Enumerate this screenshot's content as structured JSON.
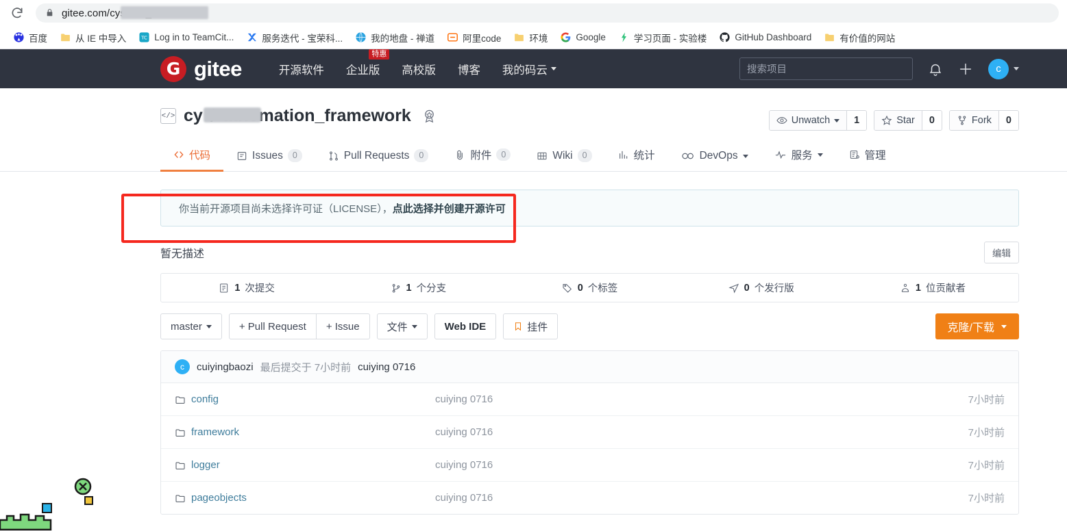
{
  "browser": {
    "reload_icon": "reload-icon",
    "lock_icon": "lock-icon",
    "url": "gitee.com/cysu                        on_framework",
    "bookmarks": [
      {
        "label": "百度",
        "icon": "baidu-icon"
      },
      {
        "label": "从 IE 中导入",
        "icon": "folder-icon"
      },
      {
        "label": "Log in to TeamCit...",
        "icon": "teamcity-icon"
      },
      {
        "label": "服务迭代 - 宝荣科...",
        "icon": "x-blue-icon"
      },
      {
        "label": "我的地盘 - 禅道",
        "icon": "globe-icon"
      },
      {
        "label": "阿里code",
        "icon": "alibaba-code-icon"
      },
      {
        "label": "环境",
        "icon": "folder-icon"
      },
      {
        "label": "Google",
        "icon": "google-icon"
      },
      {
        "label": "学习页面 - 实验楼",
        "icon": "shiyanlou-icon"
      },
      {
        "label": "GitHub Dashboard",
        "icon": "github-icon"
      },
      {
        "label": "有价值的网站",
        "icon": "folder-icon"
      }
    ]
  },
  "site_header": {
    "brand_mark": "G",
    "brand_name": "gitee",
    "nav": [
      {
        "label": "开源软件",
        "badge": "",
        "caret": false
      },
      {
        "label": "企业版",
        "badge": "特惠",
        "caret": false
      },
      {
        "label": "高校版",
        "badge": "",
        "caret": false
      },
      {
        "label": "博客",
        "badge": "",
        "caret": false
      },
      {
        "label": "我的码云",
        "badge": "",
        "caret": true
      }
    ],
    "search_placeholder": "搜索项目",
    "bell_icon": "bell-icon",
    "plus_icon": "plus-icon",
    "avatar_letter": "c"
  },
  "repo": {
    "kind_icon": "code-repo-icon",
    "owner": "cy",
    "separator": "/",
    "name": "automation_framework",
    "medal_icon": "medal-icon",
    "actions": {
      "watch_label": "Unwatch",
      "watch_count": "1",
      "star_label": "Star",
      "star_count": "0",
      "fork_label": "Fork",
      "fork_count": "0"
    },
    "tabs": [
      {
        "label": "代码",
        "count": "",
        "icon": "code-icon",
        "active": true,
        "caret": false
      },
      {
        "label": "Issues",
        "count": "0",
        "icon": "issue-icon",
        "active": false,
        "caret": false
      },
      {
        "label": "Pull Requests",
        "count": "0",
        "icon": "pull-request-icon",
        "active": false,
        "caret": false
      },
      {
        "label": "附件",
        "count": "0",
        "icon": "paperclip-icon",
        "active": false,
        "caret": false
      },
      {
        "label": "Wiki",
        "count": "0",
        "icon": "book-icon",
        "active": false,
        "caret": false
      },
      {
        "label": "统计",
        "count": "",
        "icon": "chart-icon",
        "active": false,
        "caret": false
      },
      {
        "label": "DevOps",
        "count": "",
        "icon": "infinity-icon",
        "active": false,
        "caret": true
      },
      {
        "label": "服务",
        "count": "",
        "icon": "pulse-icon",
        "active": false,
        "caret": true
      },
      {
        "label": "管理",
        "count": "",
        "icon": "settings-list-icon",
        "active": false,
        "caret": false
      }
    ]
  },
  "license_banner": {
    "text": "你当前开源项目尚未选择许可证（LICENSE），",
    "link": "点此选择并创建开源许可"
  },
  "description": {
    "text": "暂无描述",
    "edit_label": "编辑"
  },
  "stats": [
    {
      "icon": "commit-icon",
      "count": "1",
      "label": "次提交"
    },
    {
      "icon": "branch-icon",
      "count": "1",
      "label": "个分支"
    },
    {
      "icon": "tag-icon",
      "count": "0",
      "label": "个标签"
    },
    {
      "icon": "release-icon",
      "count": "0",
      "label": "个发行版"
    },
    {
      "icon": "contributor-icon",
      "count": "1",
      "label": "位贡献者"
    }
  ],
  "toolbar": {
    "branch_label": "master",
    "pull_request_label": "+ Pull Request",
    "issue_label": "+ Issue",
    "files_label": "文件",
    "web_ide_label": "Web IDE",
    "widget_label": "挂件",
    "widget_icon": "bookmark-icon",
    "clone_label": "克隆/下载"
  },
  "commit_bar": {
    "avatar_letter": "c",
    "author": "cuiyingbaozi",
    "meta": "最后提交于 7小时前",
    "message": "cuiying 0716"
  },
  "files": [
    {
      "icon": "folder-icon",
      "name": "config",
      "commit": "cuiying 0716",
      "time": "7小时前"
    },
    {
      "icon": "folder-icon",
      "name": "framework",
      "commit": "cuiying 0716",
      "time": "7小时前"
    },
    {
      "icon": "folder-icon",
      "name": "logger",
      "commit": "cuiying 0716",
      "time": "7小时前"
    },
    {
      "icon": "folder-icon",
      "name": "pageobjects",
      "commit": "cuiying 0716",
      "time": "7小时前"
    }
  ],
  "overlay": {
    "close_icon": "close-circle-icon",
    "note": "pixel-art-decoration"
  },
  "colors": {
    "header_bg": "#2f3440",
    "brand_red": "#c71d23",
    "accent_orange": "#f08016",
    "annotation_red": "#f5281e",
    "link_blue": "#3f7d9c"
  }
}
